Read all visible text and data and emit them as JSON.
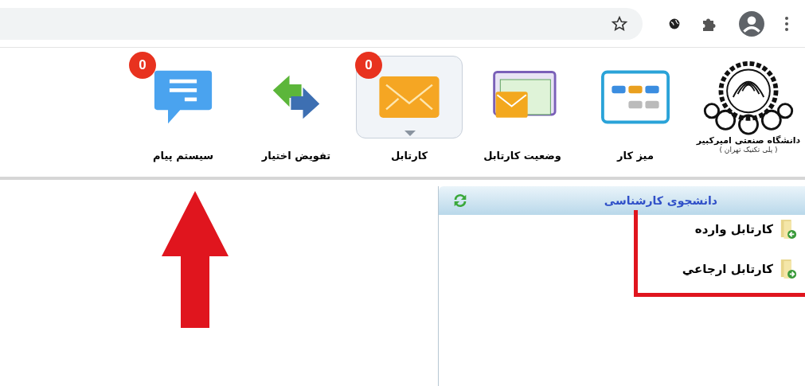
{
  "logo": {
    "name": "دانشگاه صنعتی امیرکبیر",
    "subtitle": "( پلی تکنیک تهران )"
  },
  "menu": [
    {
      "kind": "desk",
      "label": "میز کار",
      "selected": false
    },
    {
      "kind": "status",
      "label": "وضعیت کارتابل",
      "selected": false
    },
    {
      "kind": "inbox",
      "label": "کارتابل",
      "selected": true,
      "badge": "0"
    },
    {
      "kind": "delegate",
      "label": "تفویض اختیار",
      "selected": false
    },
    {
      "kind": "message",
      "label": "سیستم پیام",
      "selected": false,
      "badge": "0"
    }
  ],
  "panel": {
    "title": "دانشجوی کارشناسی",
    "items": [
      {
        "label": "کارتابل وارده",
        "kind": "in"
      },
      {
        "label": "کارتابل ارجاعي",
        "kind": "out"
      }
    ]
  }
}
